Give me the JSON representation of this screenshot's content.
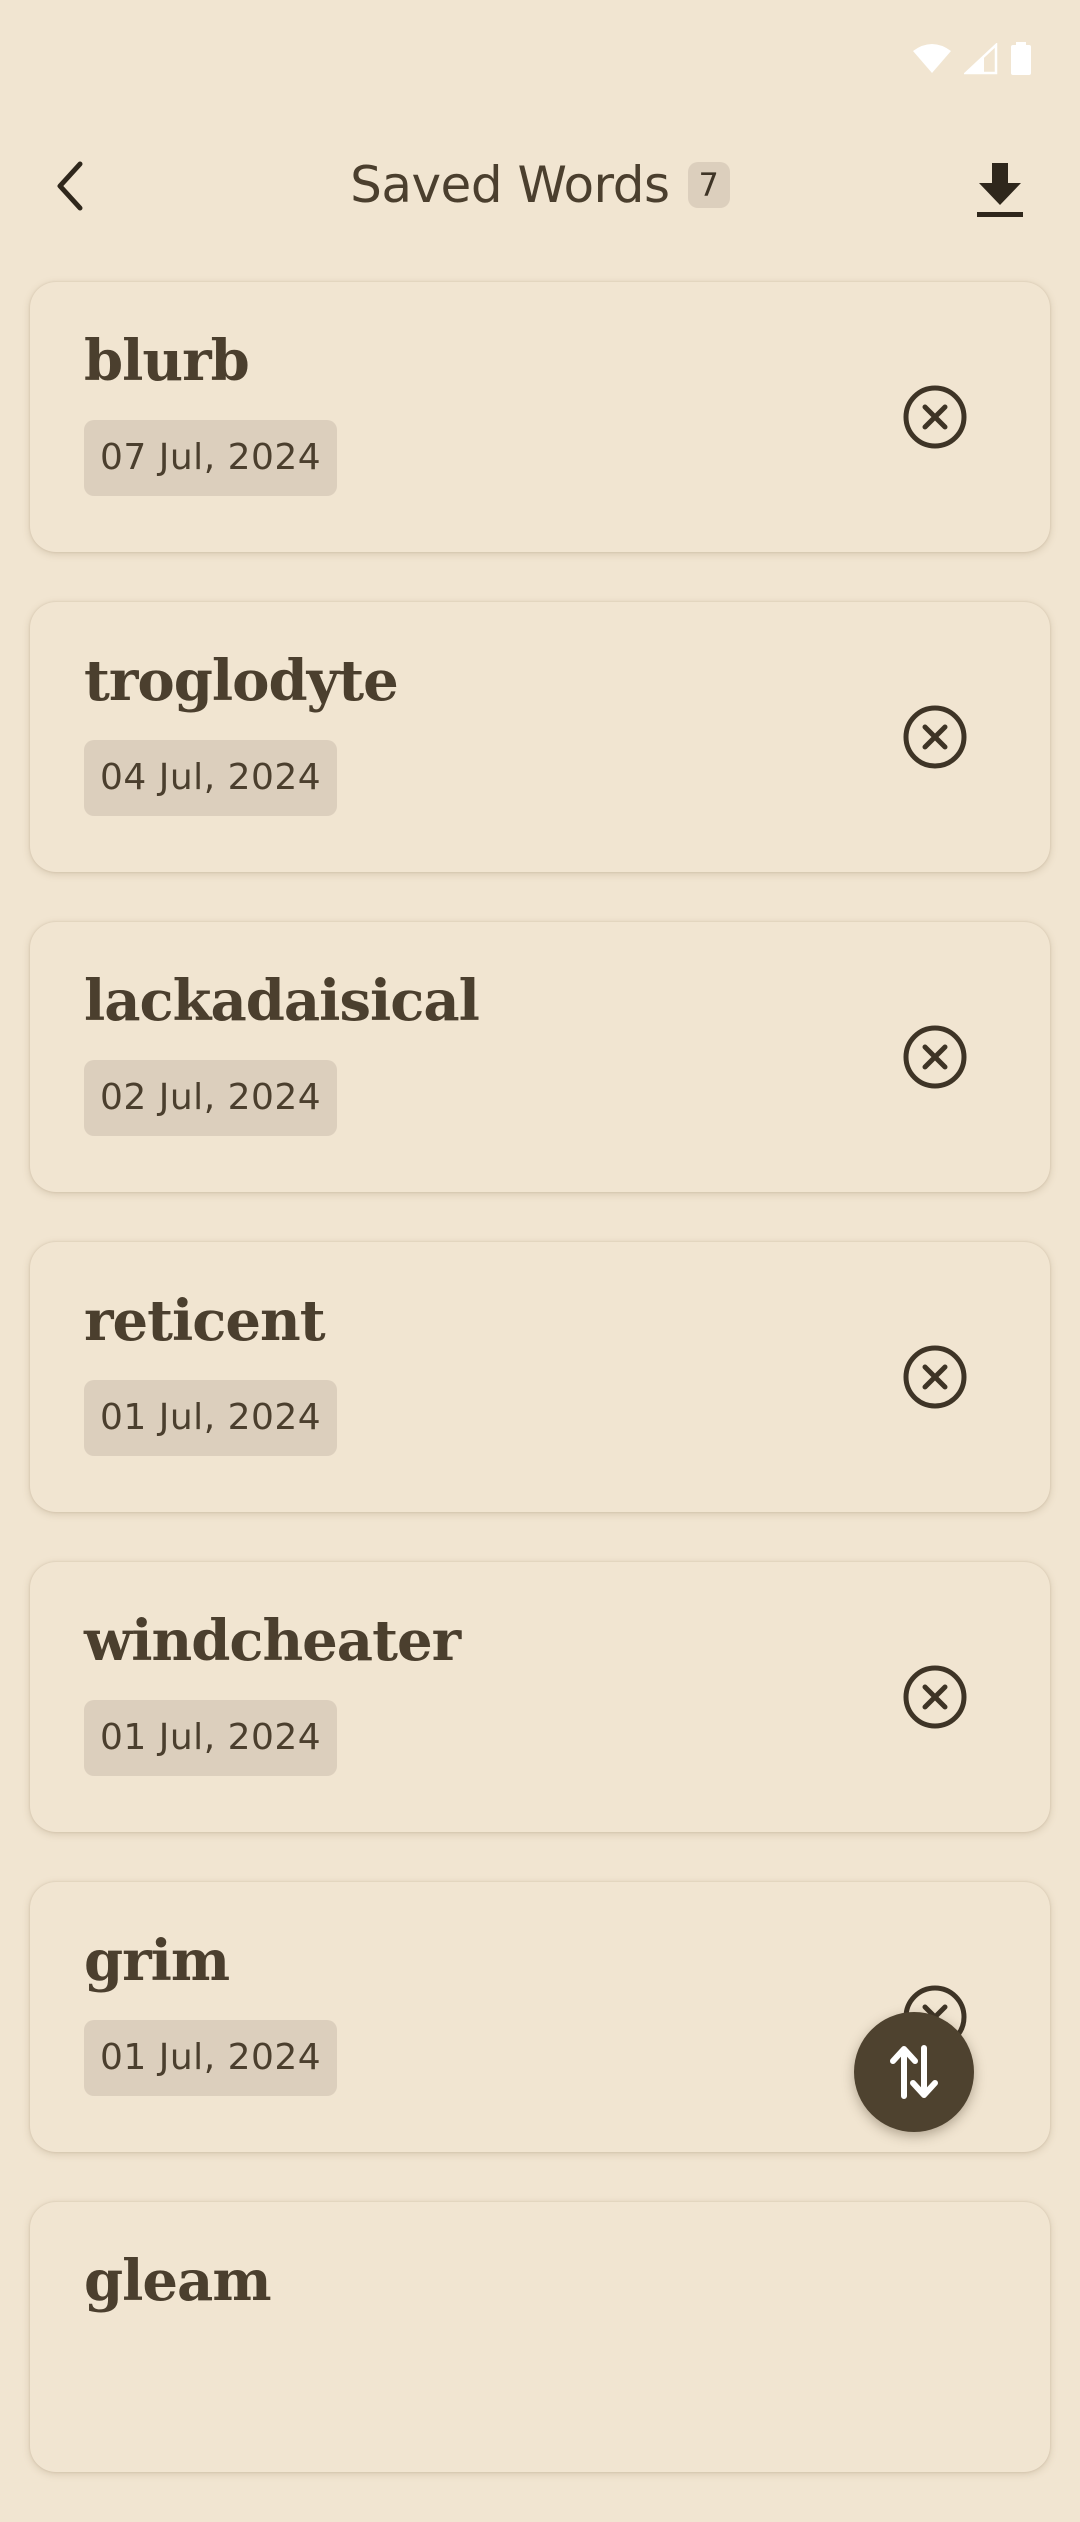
{
  "header": {
    "title": "Saved Words",
    "count": "7"
  },
  "words": [
    {
      "word": "blurb",
      "date": "07 Jul, 2024"
    },
    {
      "word": "troglodyte",
      "date": "04 Jul, 2024"
    },
    {
      "word": "lackadaisical",
      "date": "02 Jul, 2024"
    },
    {
      "word": "reticent",
      "date": "01 Jul, 2024"
    },
    {
      "word": "windcheater",
      "date": "01 Jul, 2024"
    },
    {
      "word": "grim",
      "date": "01 Jul, 2024"
    },
    {
      "word": "gleam",
      "date": ""
    }
  ],
  "icons": {
    "back": "chevron-left-icon",
    "download": "download-icon",
    "remove": "close-circle-icon",
    "sort": "swap-vertical-icon",
    "wifi": "wifi-icon",
    "signal": "signal-icon",
    "battery": "battery-icon"
  },
  "colors": {
    "background": "#F1E5D1",
    "text": "#4B3F2E",
    "chip": "#DCCFBD",
    "fab": "#4E422F"
  }
}
